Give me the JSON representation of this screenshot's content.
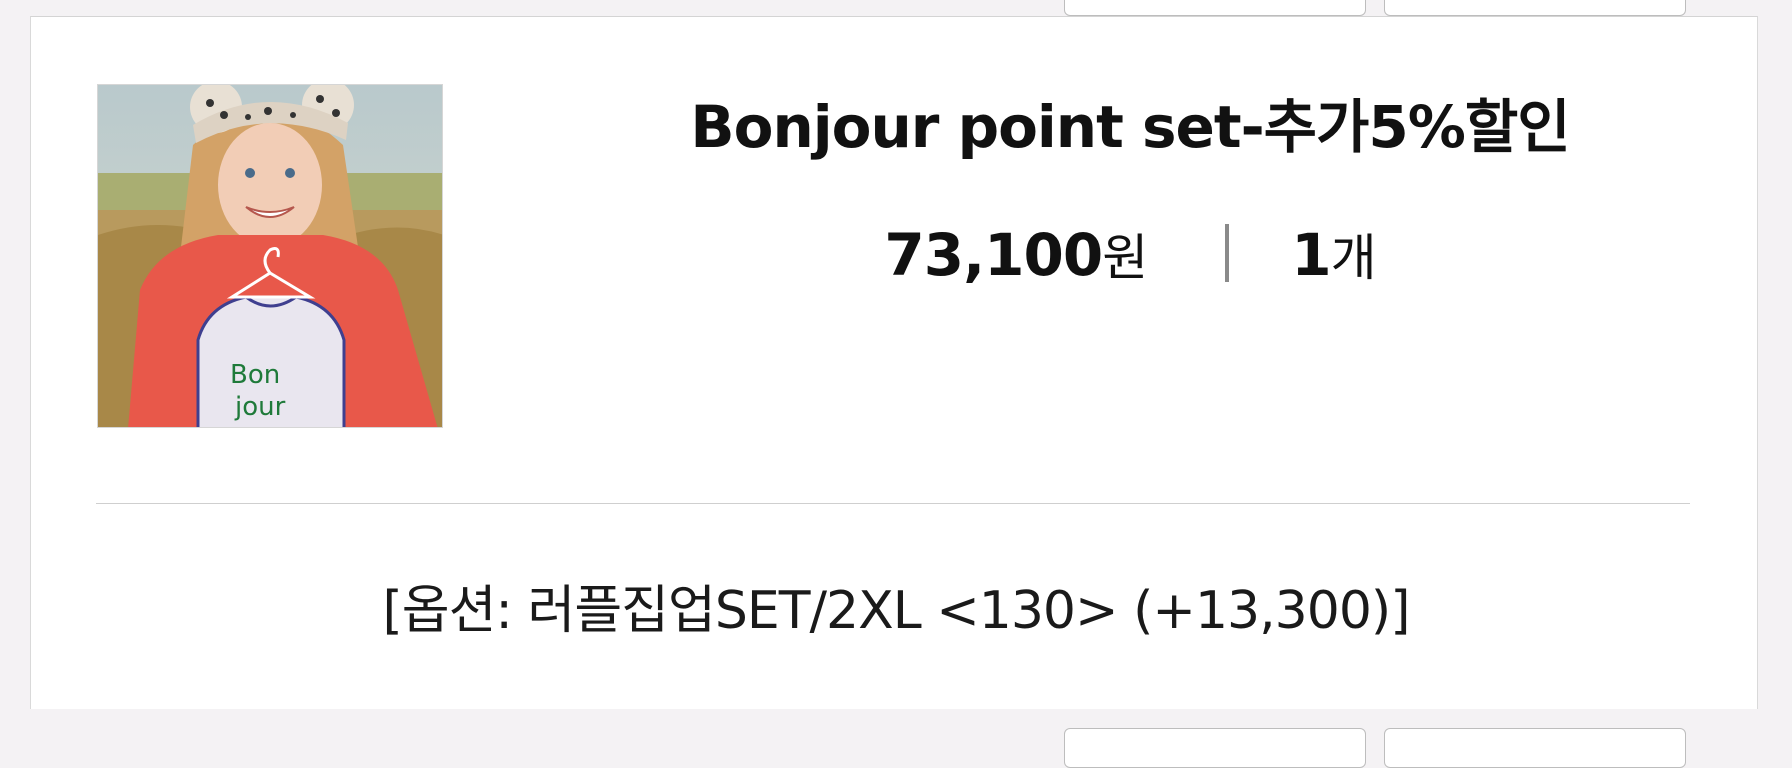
{
  "product": {
    "title": "Bonjour point set-추가5%할인",
    "price": "73,100",
    "price_unit": "원",
    "quantity": "1",
    "quantity_unit": "개",
    "option": "[옵션: 러플집업SET/2XL <130> (+13,300)]",
    "image_text": [
      "Bon",
      "jour"
    ]
  },
  "colors": {
    "sweatshirt": "#e8584a",
    "background": "#f4f2f4",
    "card": "#ffffff"
  }
}
